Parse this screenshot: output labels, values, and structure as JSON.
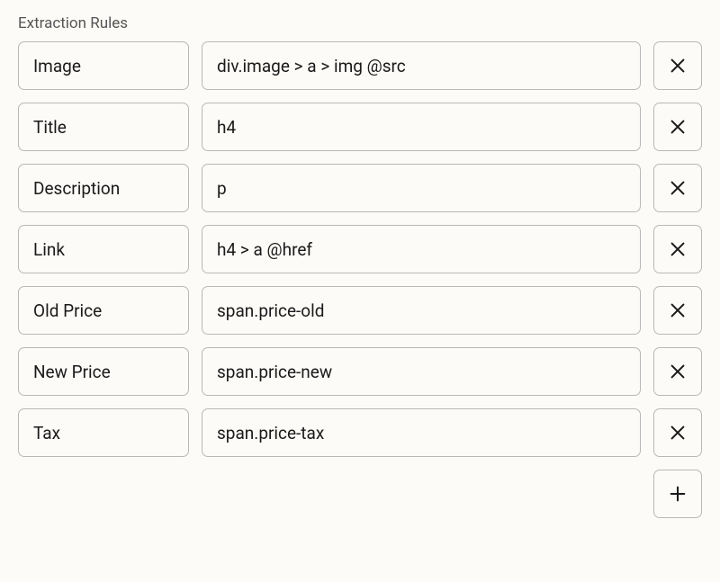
{
  "section": {
    "label": "Extraction Rules"
  },
  "rules": [
    {
      "name": "Image",
      "selector": "div.image > a > img @src"
    },
    {
      "name": "Title",
      "selector": "h4"
    },
    {
      "name": "Description",
      "selector": "p"
    },
    {
      "name": "Link",
      "selector": "h4 > a @href"
    },
    {
      "name": "Old Price",
      "selector": "span.price-old"
    },
    {
      "name": "New Price",
      "selector": "span.price-new"
    },
    {
      "name": "Tax",
      "selector": "span.price-tax"
    }
  ]
}
